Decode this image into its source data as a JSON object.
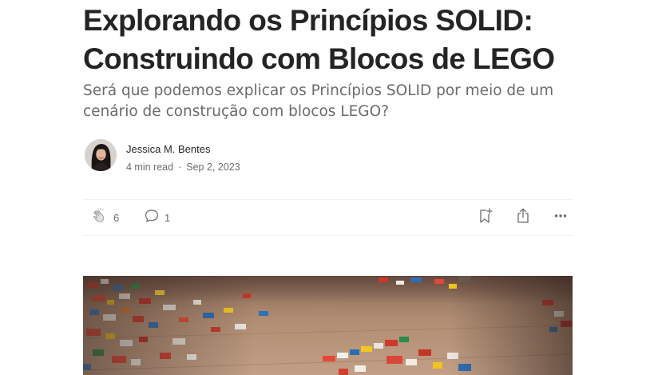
{
  "article": {
    "title_line1": "Explorando os Princípios SOLID:",
    "title_line2": "Construindo com Blocos de LEGO",
    "subtitle_line1": "Será que podemos explicar os Princípios SOLID por meio de um",
    "subtitle_line2": "cenário de construção com blocos LEGO?"
  },
  "author": {
    "name": "Jessica M. Bentes",
    "read_time": "4 min read",
    "separator": "·",
    "date": "Sep 2, 2023"
  },
  "actions": {
    "claps": "6",
    "responses": "1"
  },
  "icons": {
    "clap": "clap-icon",
    "response": "response-bubble-icon",
    "save": "bookmark-add-icon",
    "share": "share-icon",
    "more": "more-horizontal-icon"
  },
  "colors": {
    "text": "#242424",
    "muted": "#6b6b6b",
    "divider": "#f2f2f2"
  }
}
